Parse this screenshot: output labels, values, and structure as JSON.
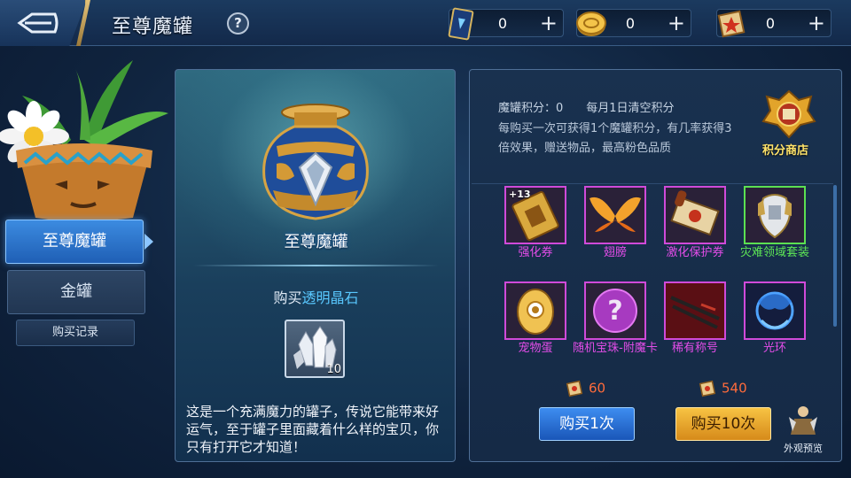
{
  "header": {
    "title": "至尊魔罐",
    "help": "?",
    "currencies": [
      {
        "icon": "card-ticket-icon",
        "value": "0",
        "plus": "+"
      },
      {
        "icon": "gold-coin-icon",
        "value": "0",
        "plus": "+"
      },
      {
        "icon": "scroll-points-icon",
        "value": "0",
        "plus": "+"
      }
    ]
  },
  "sidebar": {
    "tabs": [
      "至尊魔罐",
      "金罐"
    ],
    "active_tab": "至尊魔罐",
    "record_button": "购买记录"
  },
  "jar_panel": {
    "jar_name": "至尊魔罐",
    "buy_prefix": "购买",
    "buy_item": "透明晶石",
    "crystal_count": "10",
    "description": "这是一个充满魔力的罐子，传说它能带来好运气，至于罐子里面藏着什么样的宝贝，你只有打开它才知道！"
  },
  "reward_panel": {
    "score_label": "魔罐积分：0",
    "reset_note": "每月1日清空积分",
    "score_desc": "每购买一次可获得1个魔罐积分，有几率获得3倍效果，赠送物品，最高粉色品质",
    "shop_label": "积分商店",
    "items": [
      {
        "name": "强化券",
        "badge": "+13",
        "quality": "pink",
        "icon": "enhance-ticket-icon"
      },
      {
        "name": "翅膀",
        "badge": "",
        "quality": "pink",
        "icon": "wings-icon"
      },
      {
        "name": "激化保护券",
        "badge": "",
        "quality": "pink",
        "icon": "protection-scroll-icon"
      },
      {
        "name": "灾难领域套装",
        "badge": "",
        "quality": "green",
        "icon": "armor-set-icon"
      },
      {
        "name": "宠物蛋",
        "badge": "",
        "quality": "pink",
        "icon": "pet-egg-icon"
      },
      {
        "name": "随机宝珠-附魔卡",
        "badge": "",
        "quality": "pink",
        "icon": "random-orb-icon"
      },
      {
        "name": "稀有称号",
        "badge": "",
        "quality": "pink",
        "icon": "rare-title-icon"
      },
      {
        "name": "光环",
        "badge": "",
        "quality": "pink",
        "icon": "aura-icon"
      }
    ],
    "price_1": "60",
    "price_10": "540",
    "buy_1_label": "购买1次",
    "buy_10_label": "购买10次",
    "preview_label": "外观预览"
  },
  "colors": {
    "pink_quality": "#e44de9",
    "green_quality": "#5de655",
    "price": "#ff6b3b",
    "accent_blue": "#3e8df0",
    "accent_gold": "#f7c343"
  }
}
